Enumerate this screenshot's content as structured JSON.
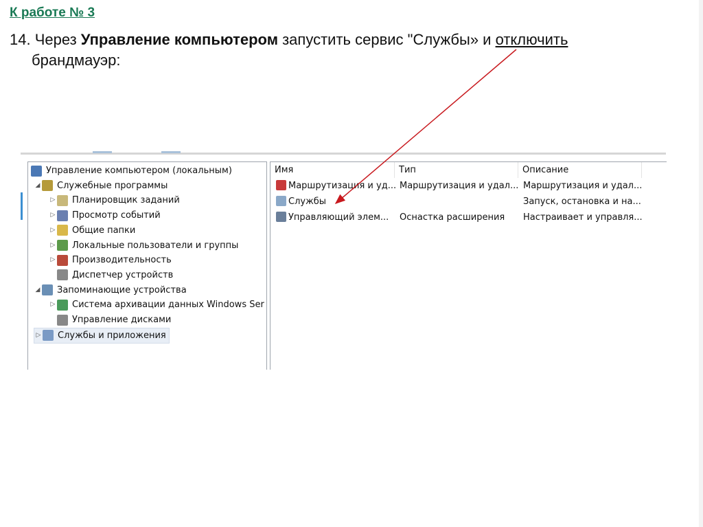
{
  "slide": {
    "title": "К работе № 3",
    "task": {
      "num": "14. Через ",
      "bold": "Управление компьютером",
      "mid": " запустить сервис  \"Службы» и ",
      "underlined": "отключить",
      "end": "брандмауэр:"
    }
  },
  "tree": [
    {
      "label": "Управление компьютером (локальным)",
      "icon": "computer-management-icon",
      "expander": ""
    },
    {
      "label": "Служебные программы",
      "icon": "tools-icon",
      "expander": "◢"
    },
    {
      "label": "Планировщик заданий",
      "icon": "clock-icon",
      "expander": "▷"
    },
    {
      "label": "Просмотр событий",
      "icon": "event-viewer-icon",
      "expander": "▷"
    },
    {
      "label": "Общие папки",
      "icon": "shared-folder-icon",
      "expander": "▷"
    },
    {
      "label": "Локальные пользователи и группы",
      "icon": "users-icon",
      "expander": "▷"
    },
    {
      "label": "Производительность",
      "icon": "performance-icon",
      "expander": "▷"
    },
    {
      "label": "Диспетчер устройств",
      "icon": "device-manager-icon",
      "expander": ""
    },
    {
      "label": "Запоминающие устройства",
      "icon": "storage-icon",
      "expander": "◢"
    },
    {
      "label": "Система архивации данных Windows Ser",
      "icon": "backup-icon",
      "expander": "▷"
    },
    {
      "label": "Управление дисками",
      "icon": "disk-icon",
      "expander": ""
    },
    {
      "label": "Службы и приложения",
      "icon": "services-apps-icon",
      "expander": "▷"
    }
  ],
  "list": {
    "columns": [
      "Имя",
      "Тип",
      "Описание"
    ],
    "rows": [
      {
        "name": "Маршрутизация и уд...",
        "type": "Маршрутизация и удал...",
        "desc": "Маршрутизация и удал...",
        "icon": "routing-icon"
      },
      {
        "name": "Службы",
        "type": "",
        "desc": "Запуск, остановка и на...",
        "icon": "gear-icon"
      },
      {
        "name": "Управляющий элем...",
        "type": "Оснастка расширения",
        "desc": "Настраивает и управля...",
        "icon": "wmi-icon"
      }
    ]
  },
  "colors": {
    "title": "#1a7a55",
    "arrow": "#c8191e"
  }
}
